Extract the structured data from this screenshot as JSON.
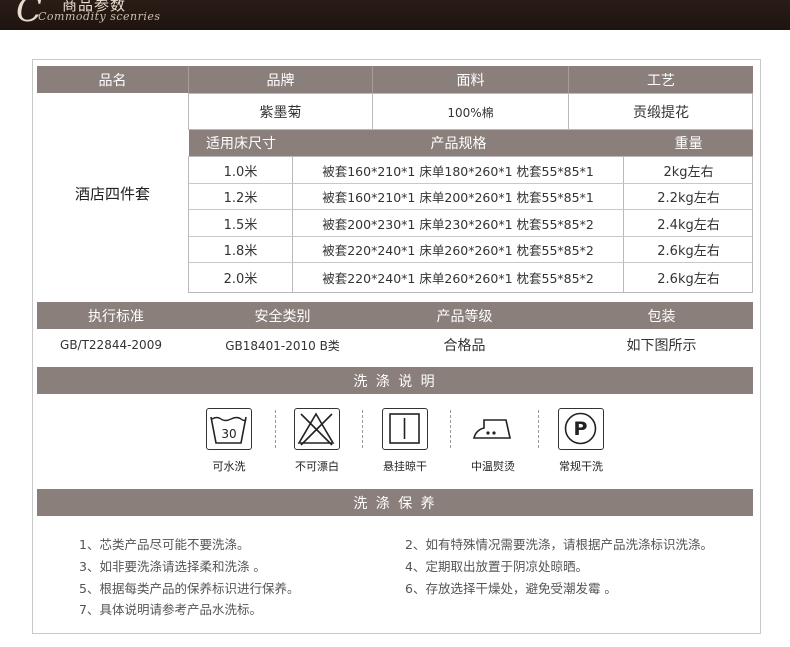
{
  "banner": {
    "title": "商品参数",
    "subtitle": "Commodity scenries",
    "logo_letter": "C"
  },
  "spec_table": {
    "headers": [
      "品名",
      "品牌",
      "面料",
      "工艺"
    ],
    "product_name": "酒店四件套",
    "brand": "紫墨菊",
    "fabric": "100%棉",
    "craft": "贡缎提花",
    "size_headers": [
      "适用床尺寸",
      "产品规格",
      "重量"
    ],
    "rows": [
      {
        "size": "1.0米",
        "spec": "被套160*210*1 床单180*260*1 枕套55*85*1",
        "weight": "2kg左右"
      },
      {
        "size": "1.2米",
        "spec": "被套160*210*1 床单200*260*1 枕套55*85*1",
        "weight": "2.2kg左右"
      },
      {
        "size": "1.5米",
        "spec": "被套200*230*1 床单230*260*1 枕套55*85*2",
        "weight": "2.4kg左右"
      },
      {
        "size": "1.8米",
        "spec": "被套220*240*1 床单260*260*1 枕套55*85*2",
        "weight": "2.6kg左右"
      },
      {
        "size": "2.0米",
        "spec": "被套220*240*1 床单260*260*1 枕套55*85*2",
        "weight": "2.6kg左右"
      }
    ]
  },
  "standards": {
    "headers": [
      "执行标准",
      "安全类别",
      "产品等级",
      "包装"
    ],
    "values": [
      "GB/T22844-2009",
      "GB18401-2010 B类",
      "合格品",
      "如下图所示"
    ]
  },
  "wash": {
    "title": "洗 涤 说 明",
    "icons": [
      {
        "icon": "wash-30-icon",
        "label": "可水洗",
        "text": "30"
      },
      {
        "icon": "no-bleach-icon",
        "label": "不可漂白"
      },
      {
        "icon": "hang-dry-icon",
        "label": "悬挂晾干"
      },
      {
        "icon": "iron-medium-icon",
        "label": "中温熨烫"
      },
      {
        "icon": "dry-clean-icon",
        "label": "常规干洗",
        "text": "P"
      }
    ]
  },
  "care": {
    "title": "洗 涤 保 养",
    "notes": [
      "1、芯类产品尽可能不要洗涤。",
      "2、如有特殊情况需要洗涤，请根据产品洗涤标识洗涤。",
      "3、如非要洗涤请选择柔和洗涤 。",
      "4、定期取出放置于阴凉处晾晒。",
      "5、根据每类产品的保养标识进行保养。",
      "6、存放选择干燥处，避免受潮发霉 。",
      "7、具体说明请参考产品水洗标。"
    ]
  }
}
